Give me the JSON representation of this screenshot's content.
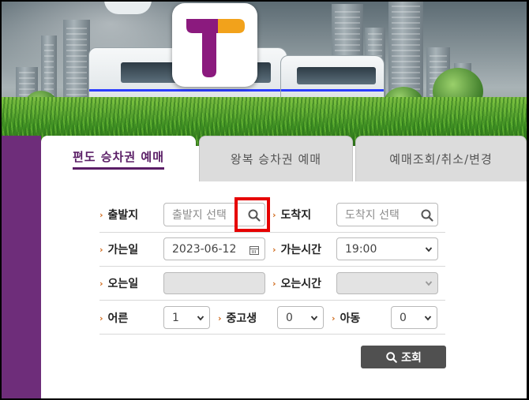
{
  "tabs": {
    "one_way": "편도 승차권 예매",
    "round_trip": "왕복 승차권 예매",
    "lookup": "예매조회/취소/변경"
  },
  "form": {
    "departure": {
      "label": "출발지",
      "placeholder": "출발지 선택"
    },
    "arrival": {
      "label": "도착지",
      "placeholder": "도착지 선택"
    },
    "depart_date": {
      "label": "가는일",
      "value": "2023-06-12"
    },
    "depart_time": {
      "label": "가는시간",
      "value": "19:00"
    },
    "return_date": {
      "label": "오는일",
      "value": ""
    },
    "return_time": {
      "label": "오는시간",
      "value": ""
    },
    "adult": {
      "label": "어른",
      "value": "1"
    },
    "student": {
      "label": "중고생",
      "value": "0"
    },
    "child": {
      "label": "아동",
      "value": "0"
    }
  },
  "search_button": {
    "label": "조회"
  },
  "colors": {
    "brand_purple": "#6e2d7a",
    "tab_active": "#5a1e66",
    "arrow": "#d06a1c",
    "highlight": "#e60000",
    "logo_orange": "#f2a21b"
  },
  "icons": [
    "search-icon",
    "calendar-icon",
    "chevron-down-icon",
    "chevron-right-icon"
  ]
}
